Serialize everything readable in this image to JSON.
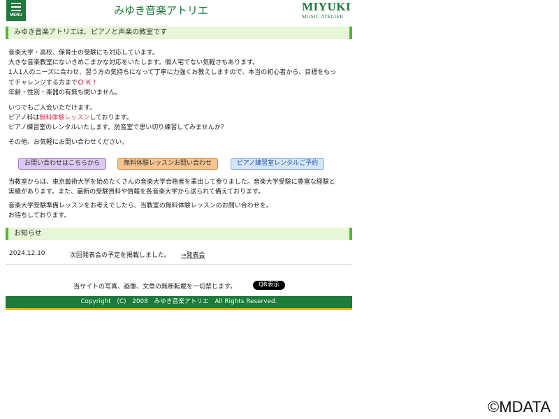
{
  "header": {
    "menu_label": "MENU",
    "site_title": "みゆき音楽アトリエ",
    "logo_main": "MIYUKI",
    "logo_sub": "MUSIC ATELIER"
  },
  "intro": {
    "heading": "みゆき音楽アトリエは、ピアノと声楽の教室です",
    "lines": [
      "音楽大学・高校、保育士の受験にも対応しています。",
      "大きな音楽教室にないきめこまかな対応をいたします。個人宅でない気軽さもあります。",
      "1人1人のニーズに合わせ、習う方の気持ちになって丁寧に力強くお教えしますので、本当の初心者から、目標をもっ",
      "てチャレンジする方まで",
      "年齢・性別・楽器の有無も問いません。"
    ],
    "ok_text": "ＯＫ！",
    "welcome": "いつでもご入会いただけます。",
    "piano_prefix": "ピアノ科は",
    "piano_highlight": "無料体験レッスン",
    "piano_suffix": "しております。",
    "rental": "ピアノ練習室のレンタルいたします。防音室で思い切り練習してみませんか？",
    "other": "その他、お気軽にお問い合わせください。"
  },
  "buttons": {
    "contact": "お問い合わせはこちらから",
    "trial": "無料体験レッスンお問い合わせ",
    "rental": "ピアノ練習室レンタルご予約"
  },
  "achievements": {
    "line1": "当教室からは、東京藝術大学を始めたくさんの音楽大学合格者を輩出して参りました。音楽大学受験に豊富な経験と",
    "line2": "実績があります。また、最新の受験資料や情報を各音楽大学から送られて備えております。",
    "line3": "音楽大学受験準備レッスンをお考えでしたら、当教室の無料体験レッスンのお問い合わせを。",
    "line4": "お待ちしております。"
  },
  "news": {
    "heading": "お知らせ",
    "items": [
      {
        "date": "2024.12.10",
        "text": "次回発表会の予定を掲載しました。",
        "link": "→発表会"
      }
    ]
  },
  "footer": {
    "note": "当サイトの写真、画像、文章の無断転載を一切禁じます。",
    "qr_label": "QR表示",
    "copyright": "Copyright　(C)　2008　みゆき音楽アトリエ　All Rights Reserved."
  },
  "watermark": "©MDATA",
  "colors": {
    "brand_green": "#1c7a3a",
    "bar_bg": "#e6f6d6",
    "bar_accent": "#57b43a",
    "highlight_red": "#e0304a",
    "footer_underline": "#f2b500"
  },
  "icons": {
    "menu": "hamburger-icon"
  }
}
